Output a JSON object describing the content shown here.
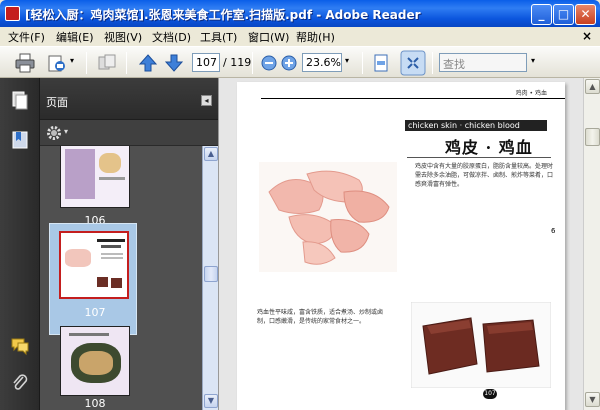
{
  "window": {
    "title": "[轻松入厨：鸡肉菜馆].张恩来美食工作室.扫描版.pdf - Adobe Reader",
    "buttons": {
      "minimize": "_",
      "maximize": "□",
      "close": "✕"
    }
  },
  "menubar": {
    "items": [
      "文件(F)",
      "编辑(E)",
      "视图(V)",
      "文档(D)",
      "工具(T)",
      "窗口(W)",
      "帮助(H)"
    ],
    "doc_close": "×"
  },
  "toolbar": {
    "page_current": "107",
    "page_total": "/ 119",
    "zoom": "23.6%",
    "search_placeholder": "查找"
  },
  "panel": {
    "title": "页面",
    "collapse_glyph": "◂",
    "thumbnails": [
      {
        "label": "106",
        "selected": false
      },
      {
        "label": "107",
        "selected": true
      },
      {
        "label": "108",
        "selected": false
      }
    ]
  },
  "document": {
    "running_head": "鸡肉 • 鸡血",
    "banner_en": "chicken skin · chicken blood",
    "title_zh": "鸡皮 · 鸡血",
    "para1": "鸡皮中含有大量的胶原蛋白，脂肪含量较高。处理时需去除多余油脂，可做凉拌、卤制、煎炸等菜肴，口感爽滑富有弹性。",
    "para2": "鸡血性平味咸，富含铁质，适合煮汤、炒制或卤制，口感嫩滑，是传统的家常食材之一。",
    "margin_mark": "6",
    "page_number": "107"
  },
  "colors": {
    "titlebar": "#0b55dd",
    "panel_bg": "#4a4a4a",
    "selection": "#a9c8e6",
    "thumb_border_selected": "#c41e1e"
  }
}
